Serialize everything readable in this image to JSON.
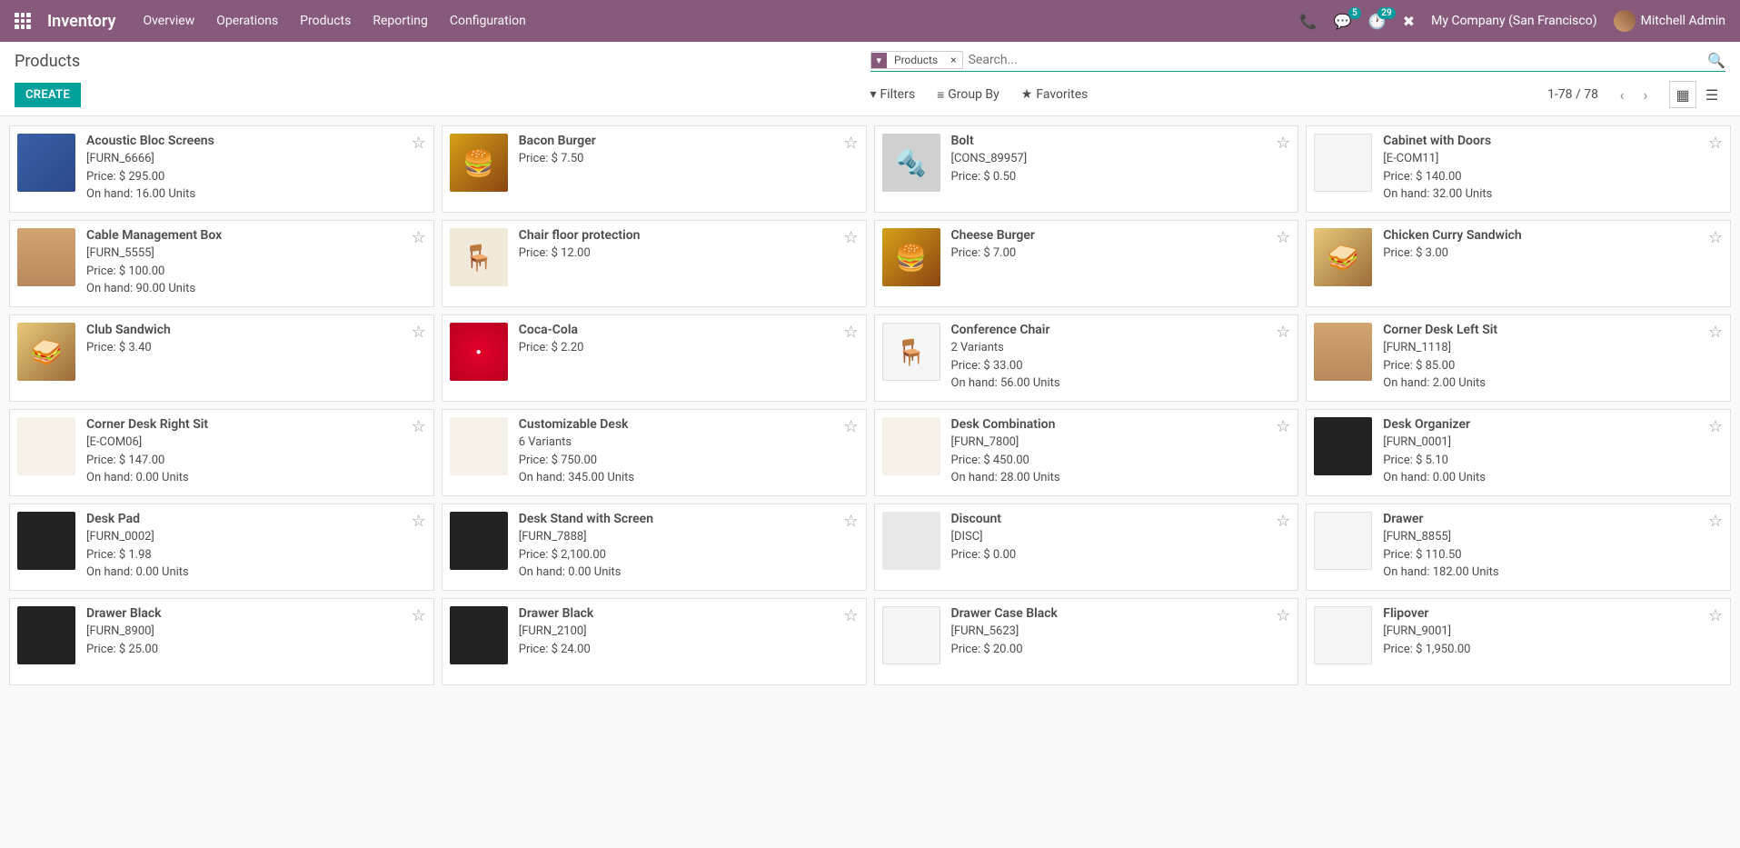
{
  "navbar": {
    "brand": "Inventory",
    "menu": [
      "Overview",
      "Operations",
      "Products",
      "Reporting",
      "Configuration"
    ],
    "messages_count": "5",
    "activities_count": "29",
    "company": "My Company (San Francisco)",
    "user": "Mitchell Admin"
  },
  "breadcrumb": "Products",
  "search": {
    "facet_label": "Products",
    "placeholder": "Search..."
  },
  "buttons": {
    "create": "CREATE"
  },
  "search_options": {
    "filters": "Filters",
    "group_by": "Group By",
    "favorites": "Favorites"
  },
  "pager": "1-78 / 78",
  "products": [
    {
      "name": "Acoustic Bloc Screens",
      "code": "[FURN_6666]",
      "price": "Price: $ 295.00",
      "onhand": "On hand: 16.00 Units",
      "thumb": "thumb-blue",
      "glyph": ""
    },
    {
      "name": "Bacon Burger",
      "code": "",
      "price": "Price: $ 7.50",
      "onhand": "",
      "thumb": "thumb-burger",
      "glyph": "🍔"
    },
    {
      "name": "Bolt",
      "code": "[CONS_89957]",
      "price": "Price: $ 0.50",
      "onhand": "",
      "thumb": "thumb-bolt",
      "glyph": "🔩"
    },
    {
      "name": "Cabinet with Doors",
      "code": "[E-COM11]",
      "price": "Price: $ 140.00",
      "onhand": "On hand: 32.00 Units",
      "thumb": "thumb-white",
      "glyph": ""
    },
    {
      "name": "Cable Management Box",
      "code": "[FURN_5555]",
      "price": "Price: $ 100.00",
      "onhand": "On hand: 90.00 Units",
      "thumb": "thumb-wood",
      "glyph": ""
    },
    {
      "name": "Chair floor protection",
      "code": "",
      "price": "Price: $ 12.00",
      "onhand": "",
      "thumb": "thumb-chair",
      "glyph": "🪑"
    },
    {
      "name": "Cheese Burger",
      "code": "",
      "price": "Price: $ 7.00",
      "onhand": "",
      "thumb": "thumb-burger",
      "glyph": "🍔"
    },
    {
      "name": "Chicken Curry Sandwich",
      "code": "",
      "price": "Price: $ 3.00",
      "onhand": "",
      "thumb": "thumb-sandwich",
      "glyph": "🥪"
    },
    {
      "name": "Club Sandwich",
      "code": "",
      "price": "Price: $ 3.40",
      "onhand": "",
      "thumb": "thumb-sandwich",
      "glyph": "🥪"
    },
    {
      "name": "Coca-Cola",
      "code": "",
      "price": "Price: $ 2.20",
      "onhand": "",
      "thumb": "thumb-red",
      "glyph": "●"
    },
    {
      "name": "Conference Chair",
      "code": "2 Variants",
      "price": "Price: $ 33.00",
      "onhand": "On hand: 56.00 Units",
      "thumb": "thumb-white",
      "glyph": "🪑"
    },
    {
      "name": "Corner Desk Left Sit",
      "code": "[FURN_1118]",
      "price": "Price: $ 85.00",
      "onhand": "On hand: 2.00 Units",
      "thumb": "thumb-wood",
      "glyph": ""
    },
    {
      "name": "Corner Desk Right Sit",
      "code": "[E-COM06]",
      "price": "Price: $ 147.00",
      "onhand": "On hand: 0.00 Units",
      "thumb": "thumb-desk",
      "glyph": ""
    },
    {
      "name": "Customizable Desk",
      "code": "6 Variants",
      "price": "Price: $ 750.00",
      "onhand": "On hand: 345.00 Units",
      "thumb": "thumb-desk",
      "glyph": ""
    },
    {
      "name": "Desk Combination",
      "code": "[FURN_7800]",
      "price": "Price: $ 450.00",
      "onhand": "On hand: 28.00 Units",
      "thumb": "thumb-desk",
      "glyph": ""
    },
    {
      "name": "Desk Organizer",
      "code": "[FURN_0001]",
      "price": "Price: $ 5.10",
      "onhand": "On hand: 0.00 Units",
      "thumb": "thumb-black",
      "glyph": ""
    },
    {
      "name": "Desk Pad",
      "code": "[FURN_0002]",
      "price": "Price: $ 1.98",
      "onhand": "On hand: 0.00 Units",
      "thumb": "thumb-black",
      "glyph": ""
    },
    {
      "name": "Desk Stand with Screen",
      "code": "[FURN_7888]",
      "price": "Price: $ 2,100.00",
      "onhand": "On hand: 0.00 Units",
      "thumb": "thumb-black",
      "glyph": ""
    },
    {
      "name": "Discount",
      "code": "[DISC]",
      "price": "Price: $ 0.00",
      "onhand": "",
      "thumb": "thumb-gray",
      "glyph": ""
    },
    {
      "name": "Drawer",
      "code": "[FURN_8855]",
      "price": "Price: $ 110.50",
      "onhand": "On hand: 182.00 Units",
      "thumb": "thumb-white",
      "glyph": ""
    },
    {
      "name": "Drawer Black",
      "code": "[FURN_8900]",
      "price": "Price: $ 25.00",
      "onhand": "",
      "thumb": "thumb-black",
      "glyph": ""
    },
    {
      "name": "Drawer Black",
      "code": "[FURN_2100]",
      "price": "Price: $ 24.00",
      "onhand": "",
      "thumb": "thumb-black",
      "glyph": ""
    },
    {
      "name": "Drawer Case Black",
      "code": "[FURN_5623]",
      "price": "Price: $ 20.00",
      "onhand": "",
      "thumb": "thumb-white",
      "glyph": ""
    },
    {
      "name": "Flipover",
      "code": "[FURN_9001]",
      "price": "Price: $ 1,950.00",
      "onhand": "",
      "thumb": "thumb-white",
      "glyph": ""
    }
  ]
}
